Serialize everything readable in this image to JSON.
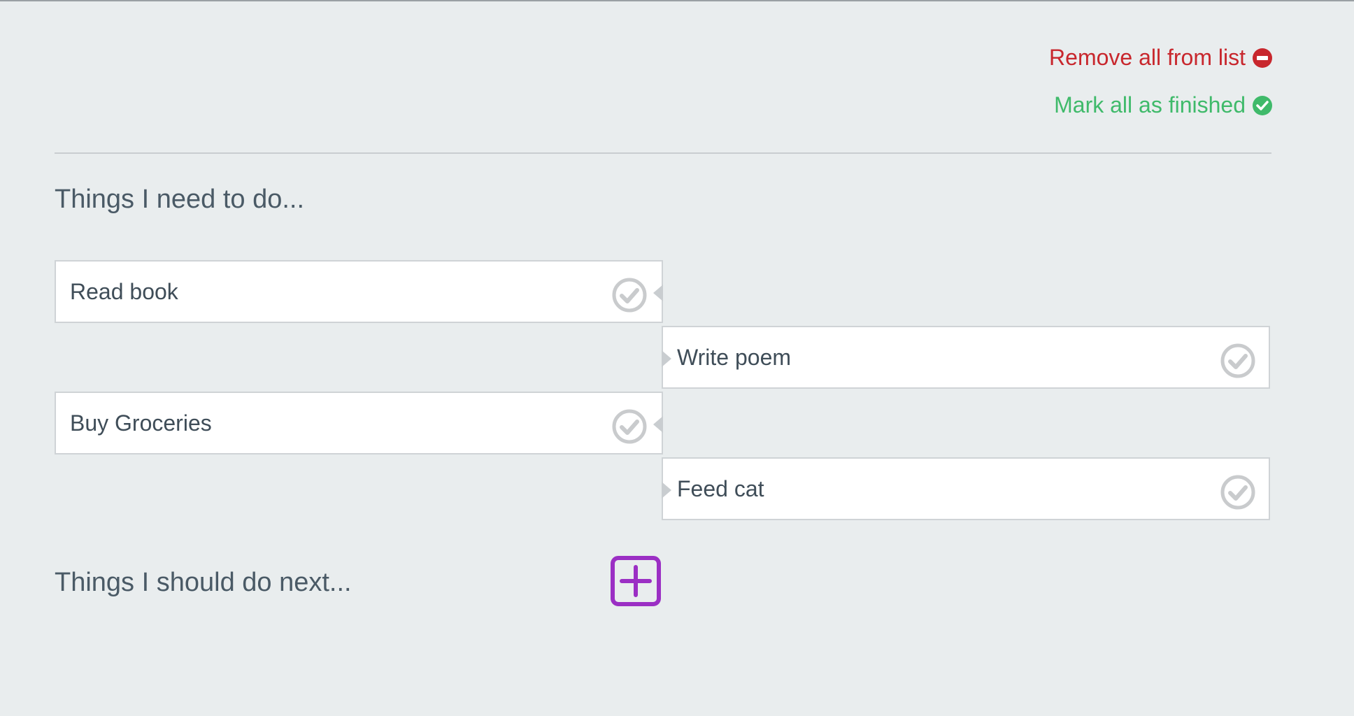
{
  "actions": {
    "remove_all_label": "Remove all from list",
    "mark_all_label": "Mark all as finished"
  },
  "sections": {
    "todo_heading": "Things I need to do...",
    "next_heading": "Things I should do next..."
  },
  "tasks": [
    {
      "label": "Read book",
      "side": "left"
    },
    {
      "label": "Write poem",
      "side": "right"
    },
    {
      "label": "Buy Groceries",
      "side": "left"
    },
    {
      "label": "Feed cat",
      "side": "right"
    }
  ],
  "icons": {
    "remove": "minus-circle-icon",
    "finish": "check-circle-icon",
    "task_check": "check-circle-outline-icon",
    "add": "plus-square-icon"
  },
  "colors": {
    "danger": "#c8272d",
    "success": "#3fba6a",
    "accent": "#9b2fc4",
    "background": "#e9edee",
    "text": "#4a5a66"
  }
}
